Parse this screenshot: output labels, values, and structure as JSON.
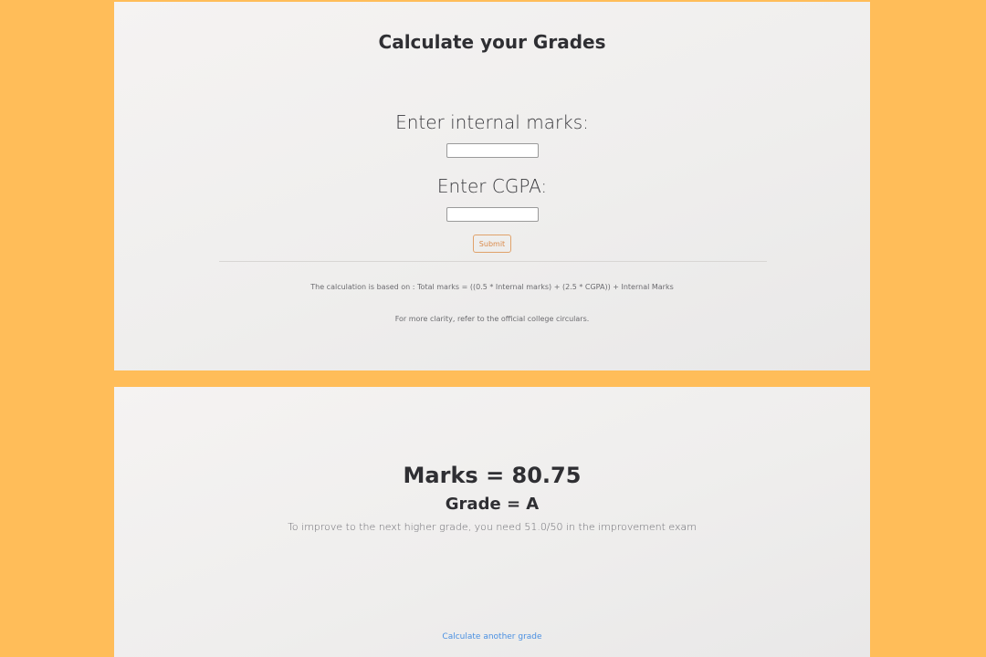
{
  "form_page": {
    "title": "Calculate your Grades",
    "internal_label": "Enter internal marks:",
    "internal_value": "",
    "cgpa_label": "Enter CGPA:",
    "cgpa_value": "",
    "submit_label": "Submit",
    "formula_note": "The calculation is based on : Total marks = ((0.5 * Internal marks) + (2.5 * CGPA)) + Internal Marks",
    "clarity_note": "For more clarity, refer to the official college circulars."
  },
  "result_page": {
    "marks_text": "Marks = 80.75",
    "grade_text": "Grade = A",
    "improve_text": "To improve to the next higher grade, you need 51.0/50 in the improvement exam",
    "again_link": "Calculate another grade"
  },
  "colors": {
    "background": "#FFBD59",
    "panel": "#F1F0EF",
    "submit_accent": "#D98A4A",
    "link": "#4A90E2"
  }
}
